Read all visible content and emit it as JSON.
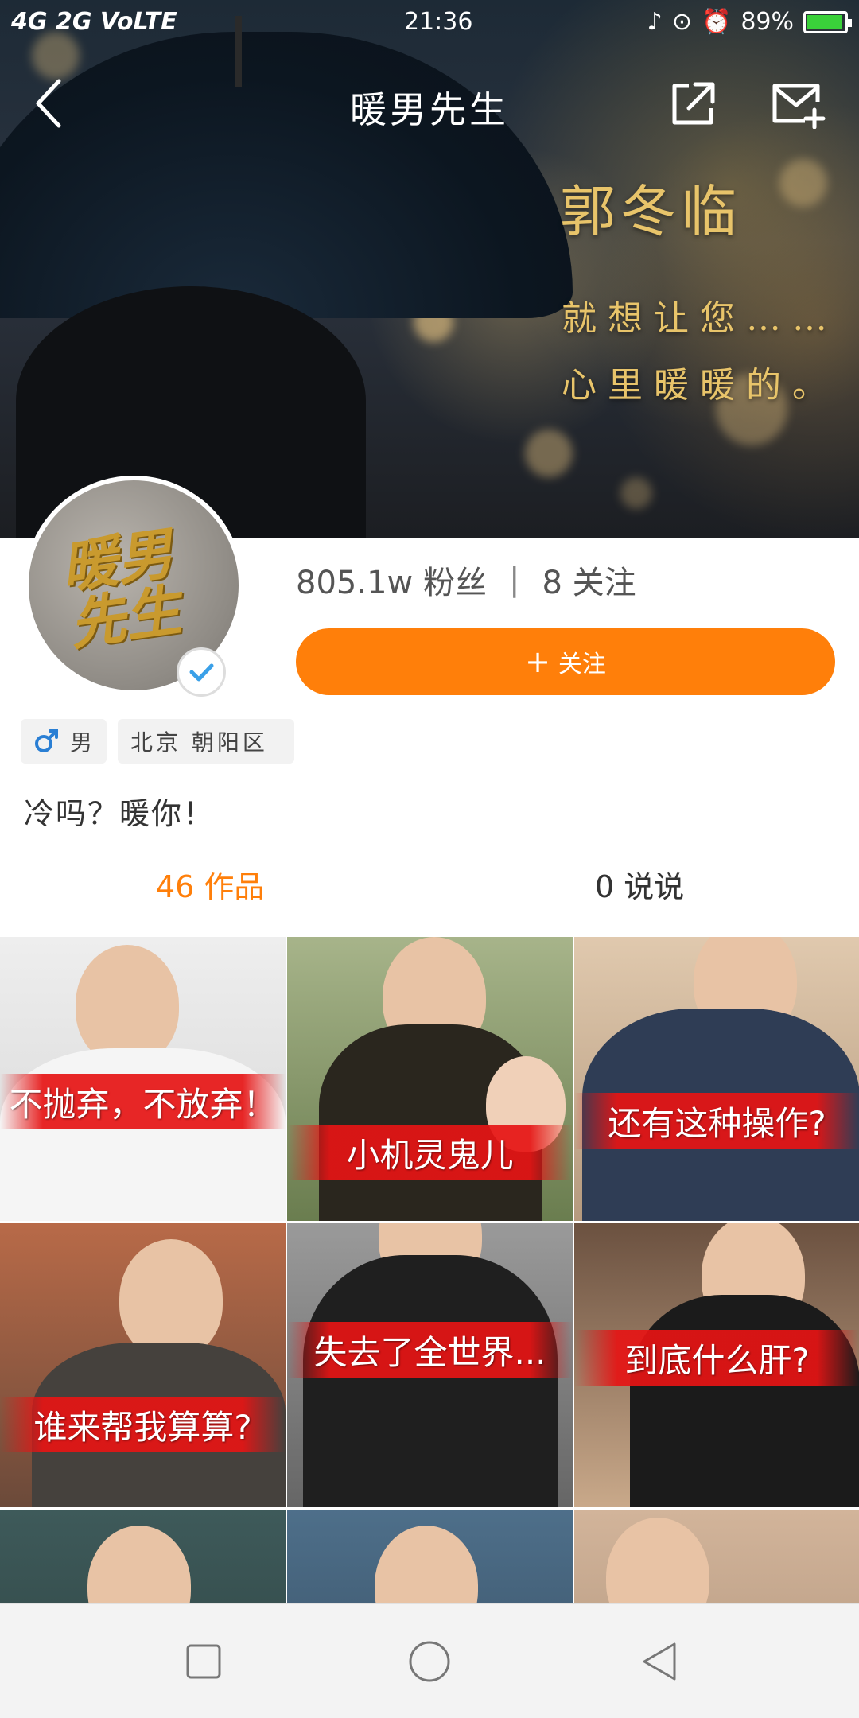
{
  "status_bar": {
    "network": "4G 2G VoLTE",
    "time": "21:36",
    "battery": "89%"
  },
  "header": {
    "title": "暖男先生",
    "banner_name": "郭冬临",
    "banner_line1": "就想让您……",
    "banner_line2": "心里暖暖的。"
  },
  "profile": {
    "avatar_text": "暖男先生",
    "fans": "805.1w 粉丝",
    "following": "8 关注",
    "follow_button": "关注",
    "gender": "男",
    "location": "北京 朝阳区",
    "bio": "冷吗？暖你！"
  },
  "tabs": {
    "works": "46 作品",
    "says": "0 说说"
  },
  "grid": {
    "captions": [
      "不抛弃，不放弃！",
      "小机灵鬼儿",
      "还有这种操作?",
      "谁来帮我算算?",
      "失去了全世界...",
      "到底什么肝?"
    ]
  },
  "icons": {
    "back": "chevron-left-icon",
    "share": "share-icon",
    "mail": "mail-add-icon",
    "verify": "check-icon",
    "gender": "male-icon",
    "nav_recent": "square-icon",
    "nav_home": "circle-icon",
    "nav_back": "triangle-back-icon"
  },
  "colors": {
    "accent": "#ff7f0a",
    "caption_red": "#e61414",
    "banner_gold": "#e8c46a"
  }
}
